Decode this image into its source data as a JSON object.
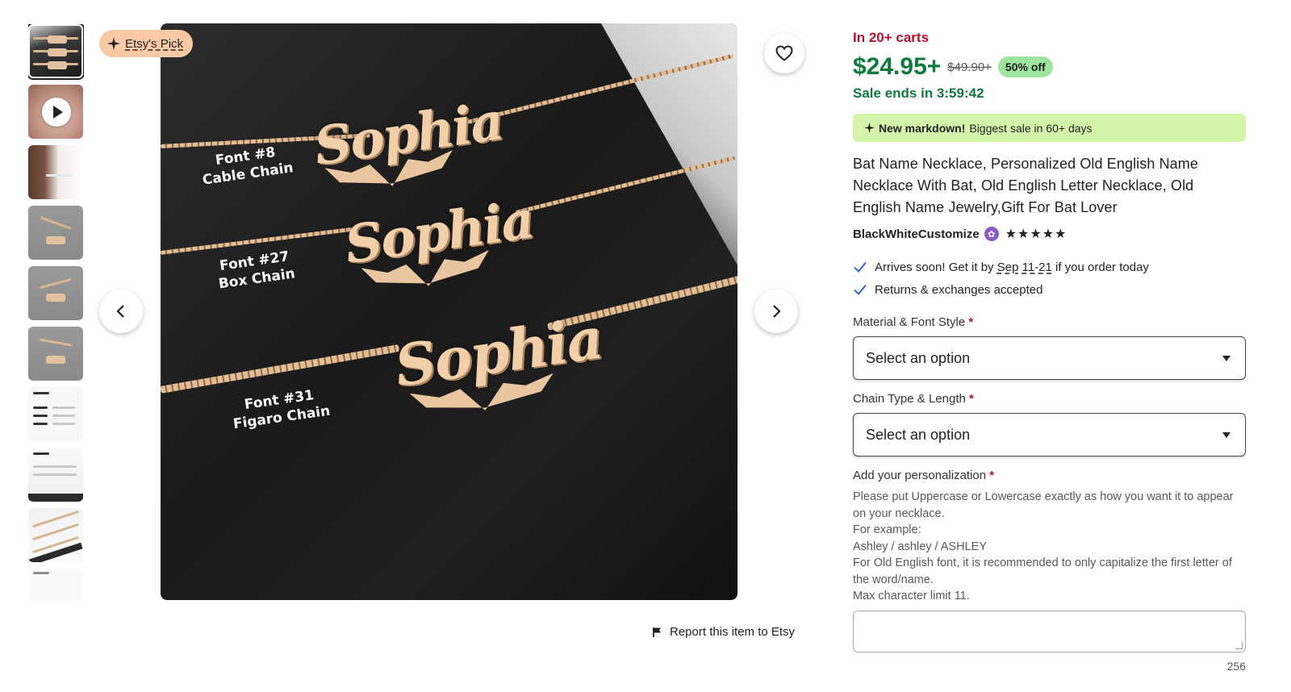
{
  "gallery": {
    "thumbnails": [
      {
        "name": "thumb-1",
        "kind": "dark",
        "selected": true
      },
      {
        "name": "thumb-2",
        "kind": "video"
      },
      {
        "name": "thumb-3",
        "kind": "model"
      },
      {
        "name": "thumb-4",
        "kind": "grey"
      },
      {
        "name": "thumb-5",
        "kind": "grey"
      },
      {
        "name": "thumb-6",
        "kind": "grey"
      },
      {
        "name": "thumb-7",
        "kind": "doc"
      },
      {
        "name": "thumb-8",
        "kind": "doc"
      },
      {
        "name": "thumb-9",
        "kind": "chain"
      },
      {
        "name": "thumb-10",
        "kind": "doc"
      }
    ],
    "badge": {
      "icon": "sparkle-icon",
      "label": "Etsy's Pick"
    },
    "image_labels": [
      {
        "line1": "Font #8",
        "line2": "Cable Chain"
      },
      {
        "line1": "Font #27",
        "line2": "Box Chain"
      },
      {
        "line1": "Font #31",
        "line2": "Figaro Chain"
      }
    ],
    "pendant_text": "Sophia",
    "favorite_icon": "heart-icon",
    "prev_icon": "chevron-left-icon",
    "next_icon": "chevron-right-icon",
    "report_icon": "flag-icon",
    "report_label": "Report this item to Etsy"
  },
  "listing": {
    "carts": "In 20+ carts",
    "price": "$24.95+",
    "original_price": "$49.90+",
    "discount": "50% off",
    "sale_ends": "Sale ends in 3:59:42",
    "markdown": {
      "icon": "sparkle-icon",
      "bold": "New markdown!",
      "text": "Biggest sale in 60+ days"
    },
    "title": "Bat Name Necklace, Personalized Old English Name Necklace With Bat, Old English Letter Necklace, Old English Name Jewelry,Gift For Bat Lover",
    "shop_name": "BlackWhiteCustomize",
    "star_seller_icon": "star-seller-badge-icon",
    "rating_stars": "★★★★★",
    "rating_value": 5,
    "perks": {
      "arrives_prefix": "Arrives soon! Get it by",
      "arrives_dates": "Sep 11-21",
      "arrives_suffix": "if you order today",
      "returns": "Returns & exchanges accepted"
    },
    "material_label": "Material & Font Style",
    "material_value": "Select an option",
    "chain_label": "Chain Type & Length",
    "chain_value": "Select an option",
    "personalization_label": "Add your personalization",
    "required_mark": "*",
    "instructions": [
      "Please put Uppercase or Lowercase exactly as how you want it to appear on your necklace.",
      "For example:",
      "Ashley / ashley / ASHLEY",
      "For Old English font, it is recommended to only capitalize the first letter of the word/name.",
      "Max character limit 11."
    ],
    "personalization_value": "",
    "char_count": "256"
  },
  "colors": {
    "sale_green": "#0e7a3d",
    "alert_red": "#b3112e",
    "badge_green": "#9ee59f",
    "markdown_bg": "#d4f5a9",
    "pick_bg": "#f9c9a6"
  }
}
